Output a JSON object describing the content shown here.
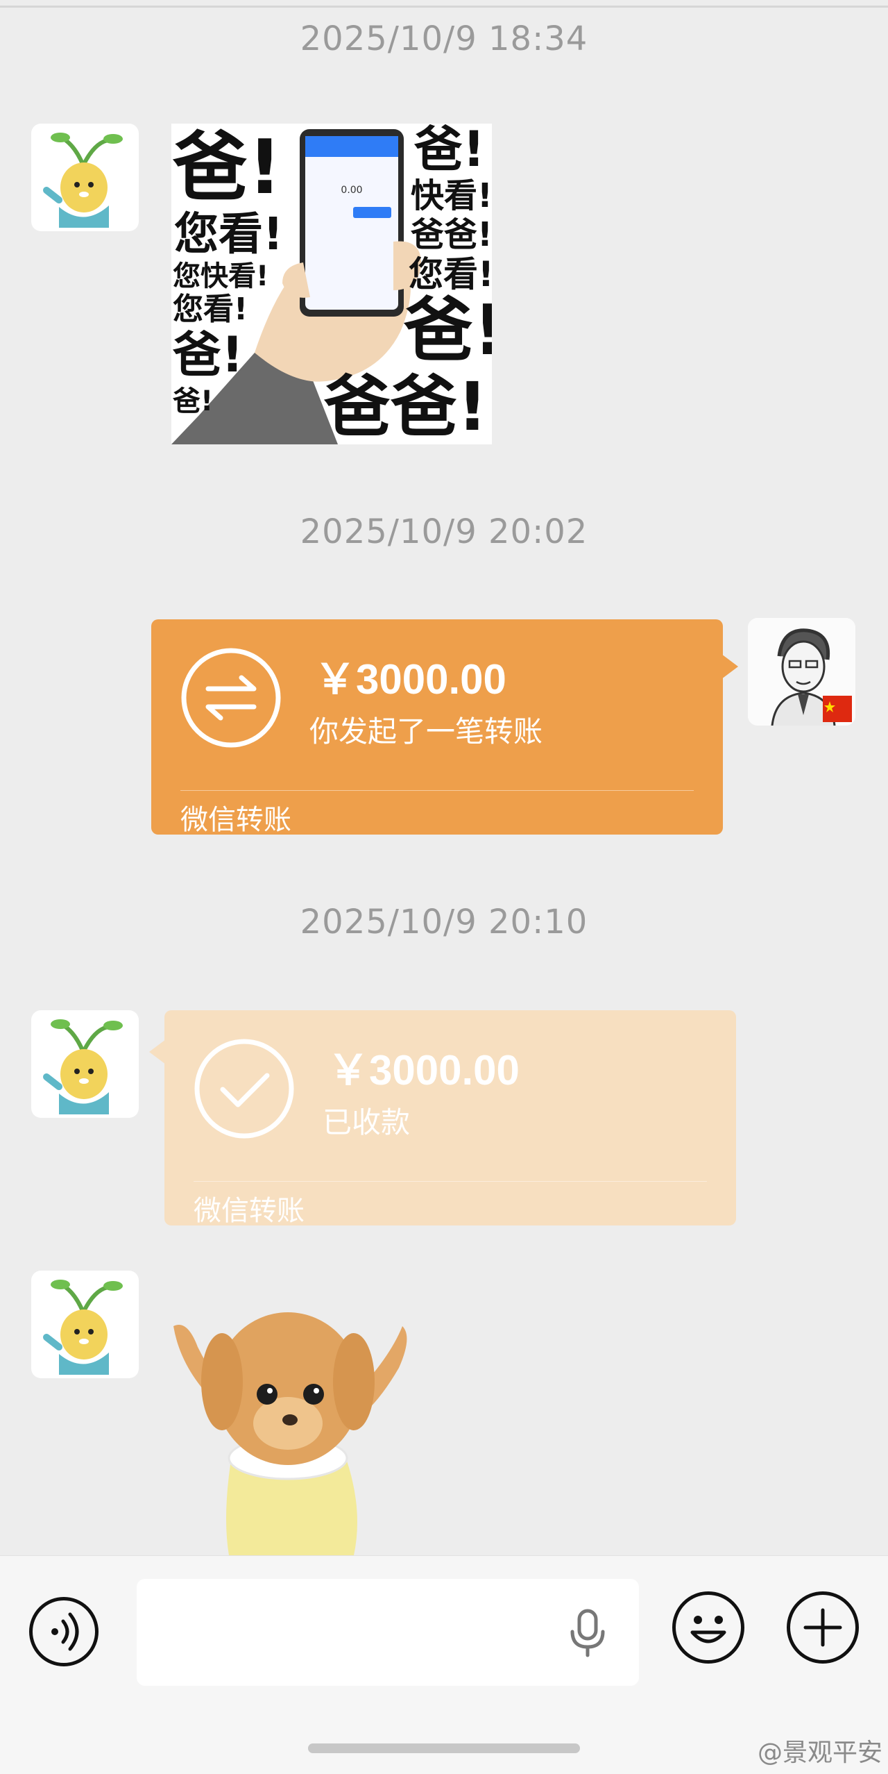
{
  "timestamps": [
    "2025/10/9 18:34",
    "2025/10/9 20:02",
    "2025/10/9 20:10"
  ],
  "meme": {
    "words": [
      "爸!",
      "您看!",
      "您快看!",
      "您看!",
      "爸!",
      "爸!",
      "爸!",
      "快看!",
      "爸爸!",
      "您看!",
      "爸!",
      "爸爸!"
    ],
    "phone_amount": "0.00"
  },
  "transfer_sent": {
    "amount": "￥3000.00",
    "description": "你发起了一笔转账",
    "source": "微信转账"
  },
  "transfer_received": {
    "amount": "￥3000.00",
    "description": "已收款",
    "source": "微信转账"
  },
  "input": {
    "placeholder": ""
  },
  "watermark": "@景观平安",
  "colors": {
    "sent_card": "#ee9f4b",
    "received_card": "#f7dfc0",
    "background": "#ededed"
  }
}
